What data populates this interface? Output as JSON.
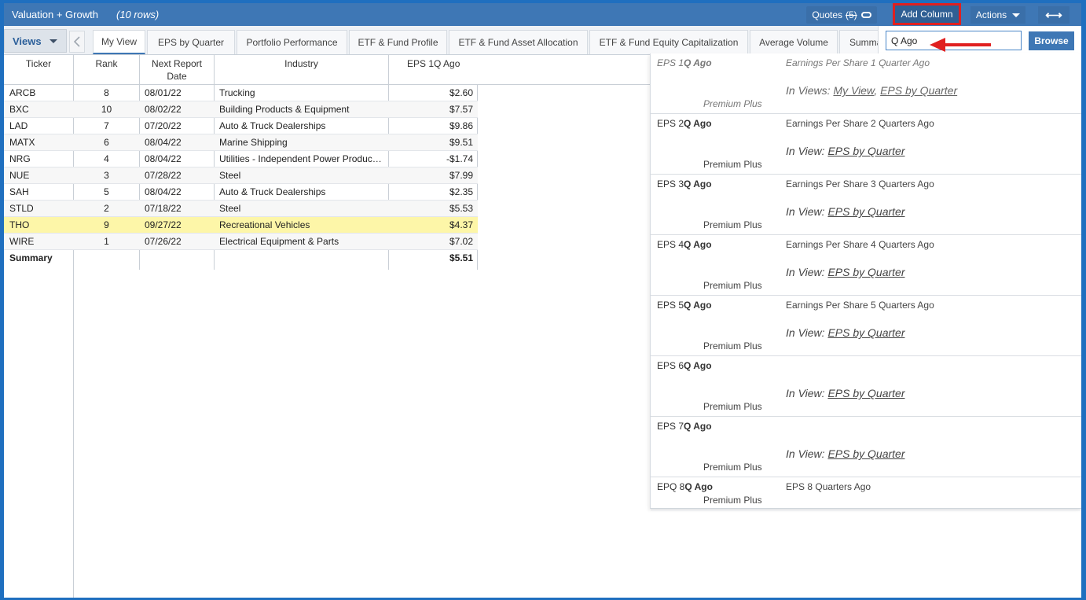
{
  "header": {
    "title": "Valuation + Growth",
    "rows": "(10 rows)",
    "quotes_label": "Quotes",
    "quotes_count": "(5)",
    "add_column_label": "Add Column",
    "actions_label": "Actions",
    "expand_glyph": "⟷"
  },
  "views_label": "Views",
  "tabs": [
    {
      "label": "My View",
      "active": true
    },
    {
      "label": "EPS by Quarter"
    },
    {
      "label": "Portfolio Performance"
    },
    {
      "label": "ETF & Fund Profile"
    },
    {
      "label": "ETF & Fund Asset Allocation"
    },
    {
      "label": "ETF & Fund Equity Capitalization"
    },
    {
      "label": "Average Volume"
    },
    {
      "label": "Summa"
    }
  ],
  "table": {
    "headers": [
      "Ticker",
      "Rank",
      "Next Report Date",
      "Industry",
      "EPS 1Q Ago"
    ],
    "rows": [
      {
        "ticker": "ARCB",
        "rank": "8",
        "date": "08/01/22",
        "industry": "Trucking",
        "eps": "$2.60"
      },
      {
        "ticker": "BXC",
        "rank": "10",
        "date": "08/02/22",
        "industry": "Building Products & Equipment",
        "eps": "$7.57"
      },
      {
        "ticker": "LAD",
        "rank": "7",
        "date": "07/20/22",
        "industry": "Auto & Truck Dealerships",
        "eps": "$9.86"
      },
      {
        "ticker": "MATX",
        "rank": "6",
        "date": "08/04/22",
        "industry": "Marine Shipping",
        "eps": "$9.51"
      },
      {
        "ticker": "NRG",
        "rank": "4",
        "date": "08/04/22",
        "industry": "Utilities - Independent Power Produc…",
        "eps": "-$1.74"
      },
      {
        "ticker": "NUE",
        "rank": "3",
        "date": "07/28/22",
        "industry": "Steel",
        "eps": "$7.99"
      },
      {
        "ticker": "SAH",
        "rank": "5",
        "date": "08/04/22",
        "industry": "Auto & Truck Dealerships",
        "eps": "$2.35"
      },
      {
        "ticker": "STLD",
        "rank": "2",
        "date": "07/18/22",
        "industry": "Steel",
        "eps": "$5.53"
      },
      {
        "ticker": "THO",
        "rank": "9",
        "date": "09/27/22",
        "industry": "Recreational Vehicles",
        "eps": "$4.37",
        "highlighted": true
      },
      {
        "ticker": "WIRE",
        "rank": "1",
        "date": "07/26/22",
        "industry": "Electrical Equipment & Parts",
        "eps": "$7.02"
      }
    ],
    "summary": {
      "label": "Summary",
      "eps": "$5.51"
    }
  },
  "search": {
    "value": "Q Ago",
    "browse_label": "Browse"
  },
  "dropdown": [
    {
      "prefix": "EPS 1",
      "match": "Q Ago",
      "desc": "Earnings Per Share 1 Quarter Ago",
      "views_prefix": "In Views: ",
      "views": [
        "My View",
        "EPS by Quarter"
      ],
      "tier": "Premium Plus"
    },
    {
      "prefix": "EPS 2",
      "match": "Q Ago",
      "desc": "Earnings Per Share 2 Quarters Ago",
      "views_prefix": "In View: ",
      "views": [
        "EPS by Quarter"
      ],
      "tier": "Premium Plus"
    },
    {
      "prefix": "EPS 3",
      "match": "Q Ago",
      "desc": "Earnings Per Share 3 Quarters Ago",
      "views_prefix": "In View: ",
      "views": [
        "EPS by Quarter"
      ],
      "tier": "Premium Plus"
    },
    {
      "prefix": "EPS 4",
      "match": "Q Ago",
      "desc": "Earnings Per Share 4 Quarters Ago",
      "views_prefix": "In View: ",
      "views": [
        "EPS by Quarter"
      ],
      "tier": "Premium Plus"
    },
    {
      "prefix": "EPS 5",
      "match": "Q Ago",
      "desc": "Earnings Per Share 5 Quarters Ago",
      "views_prefix": "In View: ",
      "views": [
        "EPS by Quarter"
      ],
      "tier": "Premium Plus"
    },
    {
      "prefix": "EPS 6",
      "match": "Q Ago",
      "desc": "",
      "views_prefix": "In View: ",
      "views": [
        "EPS by Quarter"
      ],
      "tier": "Premium Plus"
    },
    {
      "prefix": "EPS 7",
      "match": "Q Ago",
      "desc": "",
      "views_prefix": "In View: ",
      "views": [
        "EPS by Quarter"
      ],
      "tier": "Premium Plus"
    },
    {
      "prefix": "EPQ 8",
      "match": "Q Ago",
      "desc": "EPS 8 Quarters Ago",
      "views_prefix": "",
      "views": [],
      "tier": "Premium Plus"
    }
  ],
  "colors": {
    "titlebar": "#3e77b5",
    "highlight_row": "#fdf6a8",
    "annotation": "#e02020"
  }
}
